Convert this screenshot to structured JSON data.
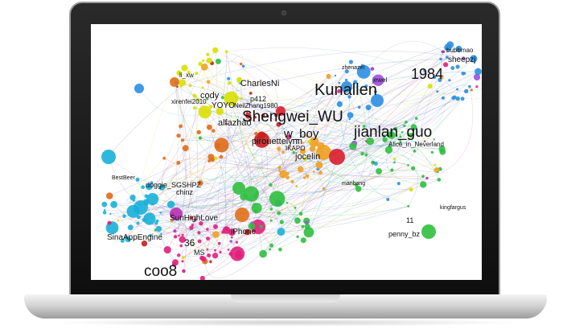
{
  "device": "laptop",
  "graph": {
    "kind": "social-network",
    "colors": {
      "edge": "#7a86c9",
      "palette": [
        "#d8e000",
        "#e06a1a",
        "#2a8fe0",
        "#c81e1e",
        "#2fbf3f",
        "#b92fb0",
        "#18b0d8",
        "#f0a020",
        "#9b4fe0",
        "#e0207a"
      ]
    },
    "labels": [
      {
        "id": "shengwei",
        "text": "Shengwei_WU"
      },
      {
        "id": "kunallen",
        "text": "Kunallen"
      },
      {
        "id": "jianlan",
        "text": "jianlan_guo"
      },
      {
        "id": "n1984",
        "text": "1984"
      },
      {
        "id": "coo8",
        "text": "coo8"
      },
      {
        "id": "charlesni",
        "text": "CharlesNi"
      },
      {
        "id": "sinaapp",
        "text": "SinaAppEngine"
      },
      {
        "id": "sunhigh",
        "text": "SunHighLove"
      },
      {
        "id": "iphone",
        "text": "iPhone"
      },
      {
        "id": "alice",
        "text": "Alice_in_Neverland"
      },
      {
        "id": "penny",
        "text": "penny_bz"
      },
      {
        "id": "pirouette",
        "text": "pirouettelynn"
      },
      {
        "id": "jocelin",
        "text": "jocelin"
      },
      {
        "id": "wboy",
        "text": "w_boy"
      },
      {
        "id": "alfazhao",
        "text": "alfazhao"
      },
      {
        "id": "cody",
        "text": "cody"
      },
      {
        "id": "yoyo",
        "text": "YOYO"
      },
      {
        "id": "neilzhang",
        "text": "NeilZhang1980"
      },
      {
        "id": "doggie",
        "text": "doggie_SGSHPZ"
      },
      {
        "id": "chinz",
        "text": "chinz"
      },
      {
        "id": "sheepzj",
        "text": "sheepzj"
      },
      {
        "id": "n36",
        "text": "36"
      },
      {
        "id": "ms",
        "text": "MS"
      },
      {
        "id": "p412",
        "text": "p412"
      },
      {
        "id": "jewel",
        "text": "jewel"
      },
      {
        "id": "kingfargus",
        "text": "kingfargus"
      },
      {
        "id": "xirenfei",
        "text": "xirenfei2010"
      },
      {
        "id": "bestbeer",
        "text": "BestBeer"
      },
      {
        "id": "n11",
        "text": "11"
      },
      {
        "id": "lixw",
        "text": "li_xw"
      },
      {
        "id": "kapo",
        "text": "IKAPO"
      },
      {
        "id": "manbang",
        "text": "manbang"
      },
      {
        "id": "zhenazel",
        "text": "zhenazel"
      },
      {
        "id": "jiehaimao",
        "text": "bubbmao"
      }
    ]
  }
}
